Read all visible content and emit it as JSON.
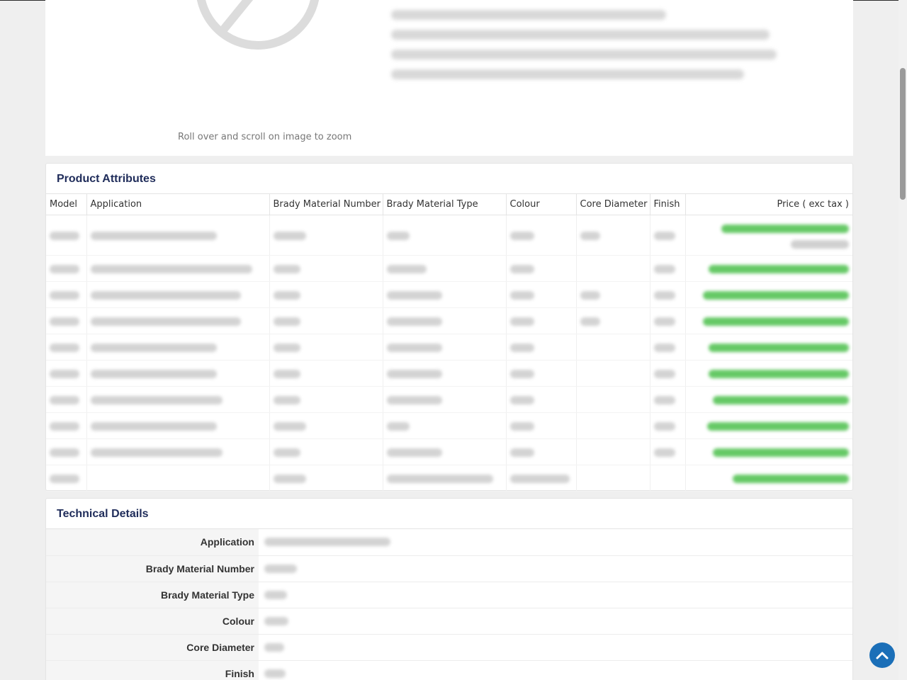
{
  "image_panel": {
    "zoom_hint": "Roll over and scroll on image to zoom"
  },
  "product_attributes": {
    "title": "Product Attributes",
    "columns": [
      "Model",
      "Application",
      "Brady Material Number",
      "Brady Material Type",
      "Colour",
      "Core Diameter",
      "Finish",
      "Price ( exc tax )"
    ],
    "row_count": 10
  },
  "technical_details": {
    "title": "Technical Details",
    "labels": [
      "Application",
      "Brady Material Number",
      "Brady Material Type",
      "Colour",
      "Core Diameter",
      "Finish"
    ]
  },
  "colors": {
    "title_color": "#1f2c5a",
    "price_color": "#4cc04c",
    "back_to_top": "#1b6fb8"
  },
  "icons": {
    "back_to_top": "chevron-up-icon",
    "no_image": "no-image-icon"
  }
}
